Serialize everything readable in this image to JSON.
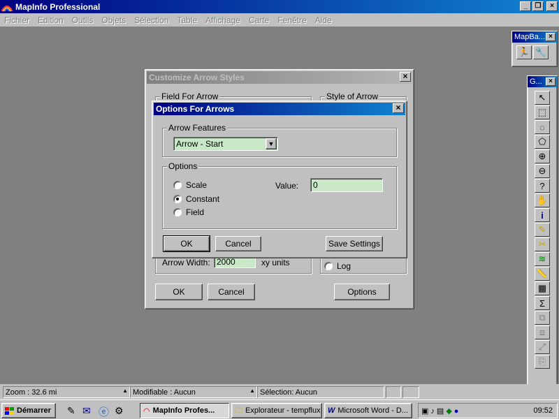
{
  "app": {
    "title": "MapInfo Professional"
  },
  "menu": [
    "Fichier",
    "Edition",
    "Outils",
    "Objets",
    "Sélection",
    "Table",
    "Affichage",
    "Carte",
    "Fenêtre",
    "Aide"
  ],
  "mapbasic_toolbar": {
    "title": "MapBa..."
  },
  "general_toolbar": {
    "title": "G..."
  },
  "customize_dialog": {
    "title": "Customize Arrow Styles",
    "field_group_label": "Field For Arrow",
    "style_group_label": "Style of Arrow",
    "arrow_width_label": "Arrow Width:",
    "arrow_width_value": "2000",
    "units_label": "xy units",
    "log_label": "Log",
    "ok_label": "OK",
    "cancel_label": "Cancel",
    "options_label": "Options"
  },
  "options_dialog": {
    "title": "Options For Arrows",
    "features_group_label": "Arrow Features",
    "features_select_value": "Arrow - Start",
    "options_group_label": "Options",
    "radio_scale": "Scale",
    "radio_constant": "Constant",
    "radio_field": "Field",
    "value_label": "Value:",
    "value_input": "0",
    "ok_label": "OK",
    "cancel_label": "Cancel",
    "save_label": "Save Settings"
  },
  "statusbar": {
    "zoom": "Zoom : 32.6 mi",
    "editable": "Modifiable : Aucun",
    "selection": "Sélection: Aucun"
  },
  "taskbar": {
    "start_label": "Démarrer",
    "tasks": [
      "MapInfo Profes...",
      "Explorateur - tempflux",
      "Microsoft Word - D..."
    ],
    "clock": "09:52"
  },
  "colors": {
    "title_active": "#000080",
    "desktop": "#808080",
    "face": "#c0c0c0",
    "field_bg": "#c8e8c8"
  }
}
